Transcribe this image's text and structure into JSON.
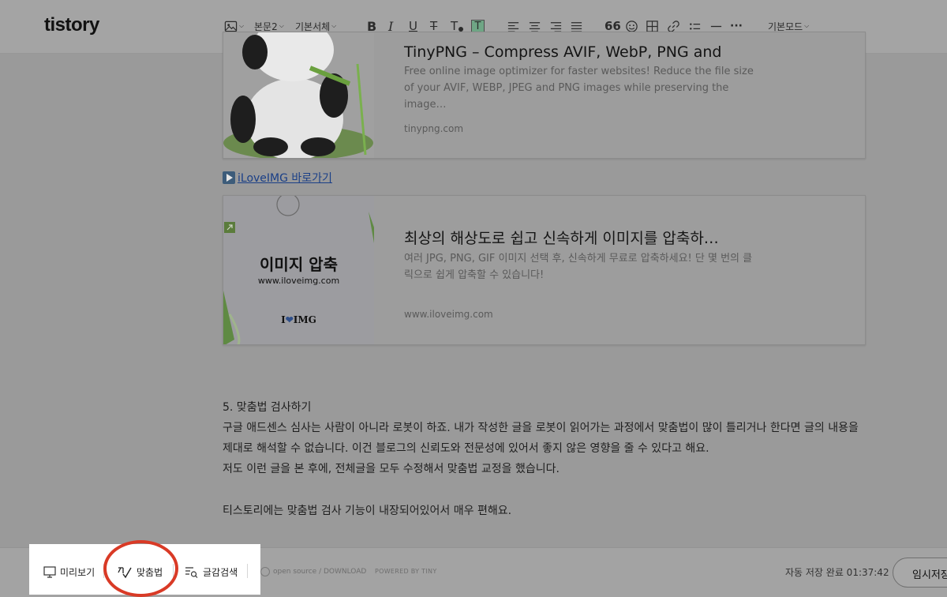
{
  "header": {
    "logo": "tistory",
    "toolbar": {
      "paragraph_style": "본문2",
      "font": "기본서체",
      "bold": "B",
      "italic": "I",
      "underline": "U",
      "strike": "T",
      "text_color": "T",
      "highlight": "T",
      "quote": "66",
      "more": "···",
      "mode": "기본모드"
    }
  },
  "content": {
    "card1": {
      "title": "TinyPNG – Compress AVIF, WebP, PNG and",
      "description": "Free online image optimizer for faster websites! Reduce the file size of your AVIF, WEBP, JPEG and PNG images while preserving the image…",
      "domain": "tinypng.com"
    },
    "link_text": "iLoveIMG 바로가기",
    "card2": {
      "title": "최상의 해상도로 쉽고 신속하게 이미지를 압축하…",
      "description": "여러 JPG, PNG, GIF 이미지 선택 후, 신속하게 무료로 압축하세요! 단 몇 번의 클릭으로 쉽게 압축할 수 있습니다!",
      "domain": "www.iloveimg.com",
      "thumb_heading": "이미지 압축",
      "thumb_url": "www.iloveimg.com",
      "thumb_logo_left": "I",
      "thumb_logo_right": "IMG"
    },
    "paragraphs": [
      "5. 맞춤법 검사하기",
      "구글 애드센스 심사는 사람이 아니라 로봇이 하죠. 내가 작성한 글을 로봇이 읽어가는 과정에서 맞춤법이 많이 틀리거나 한다면 글의 내용을",
      "제대로 해석할 수 없습니다. 이건 블로그의 신뢰도와 전문성에 있어서 좋지 않은 영향을 줄 수 있다고 해요.",
      "저도 이런 글을 본 후에, 전체글을 모두 수정해서 맞춤법 교정을 했습니다.",
      "티스토리에는 맞춤법 검사 기능이 내장되어있어서 매우 편해요."
    ]
  },
  "bottom": {
    "preview": "미리보기",
    "spellcheck": "맞춤법",
    "material_search": "글감검색",
    "open_source": "open source / DOWNLOAD",
    "powered": "POWERED BY TINY",
    "autosave": "자동 저장 완료 01:37:42",
    "temp_save": "임시저장"
  },
  "colors": {
    "overlay": "#9a9a9a",
    "highlight_ring": "#d93a26",
    "link": "#1a3f87"
  }
}
